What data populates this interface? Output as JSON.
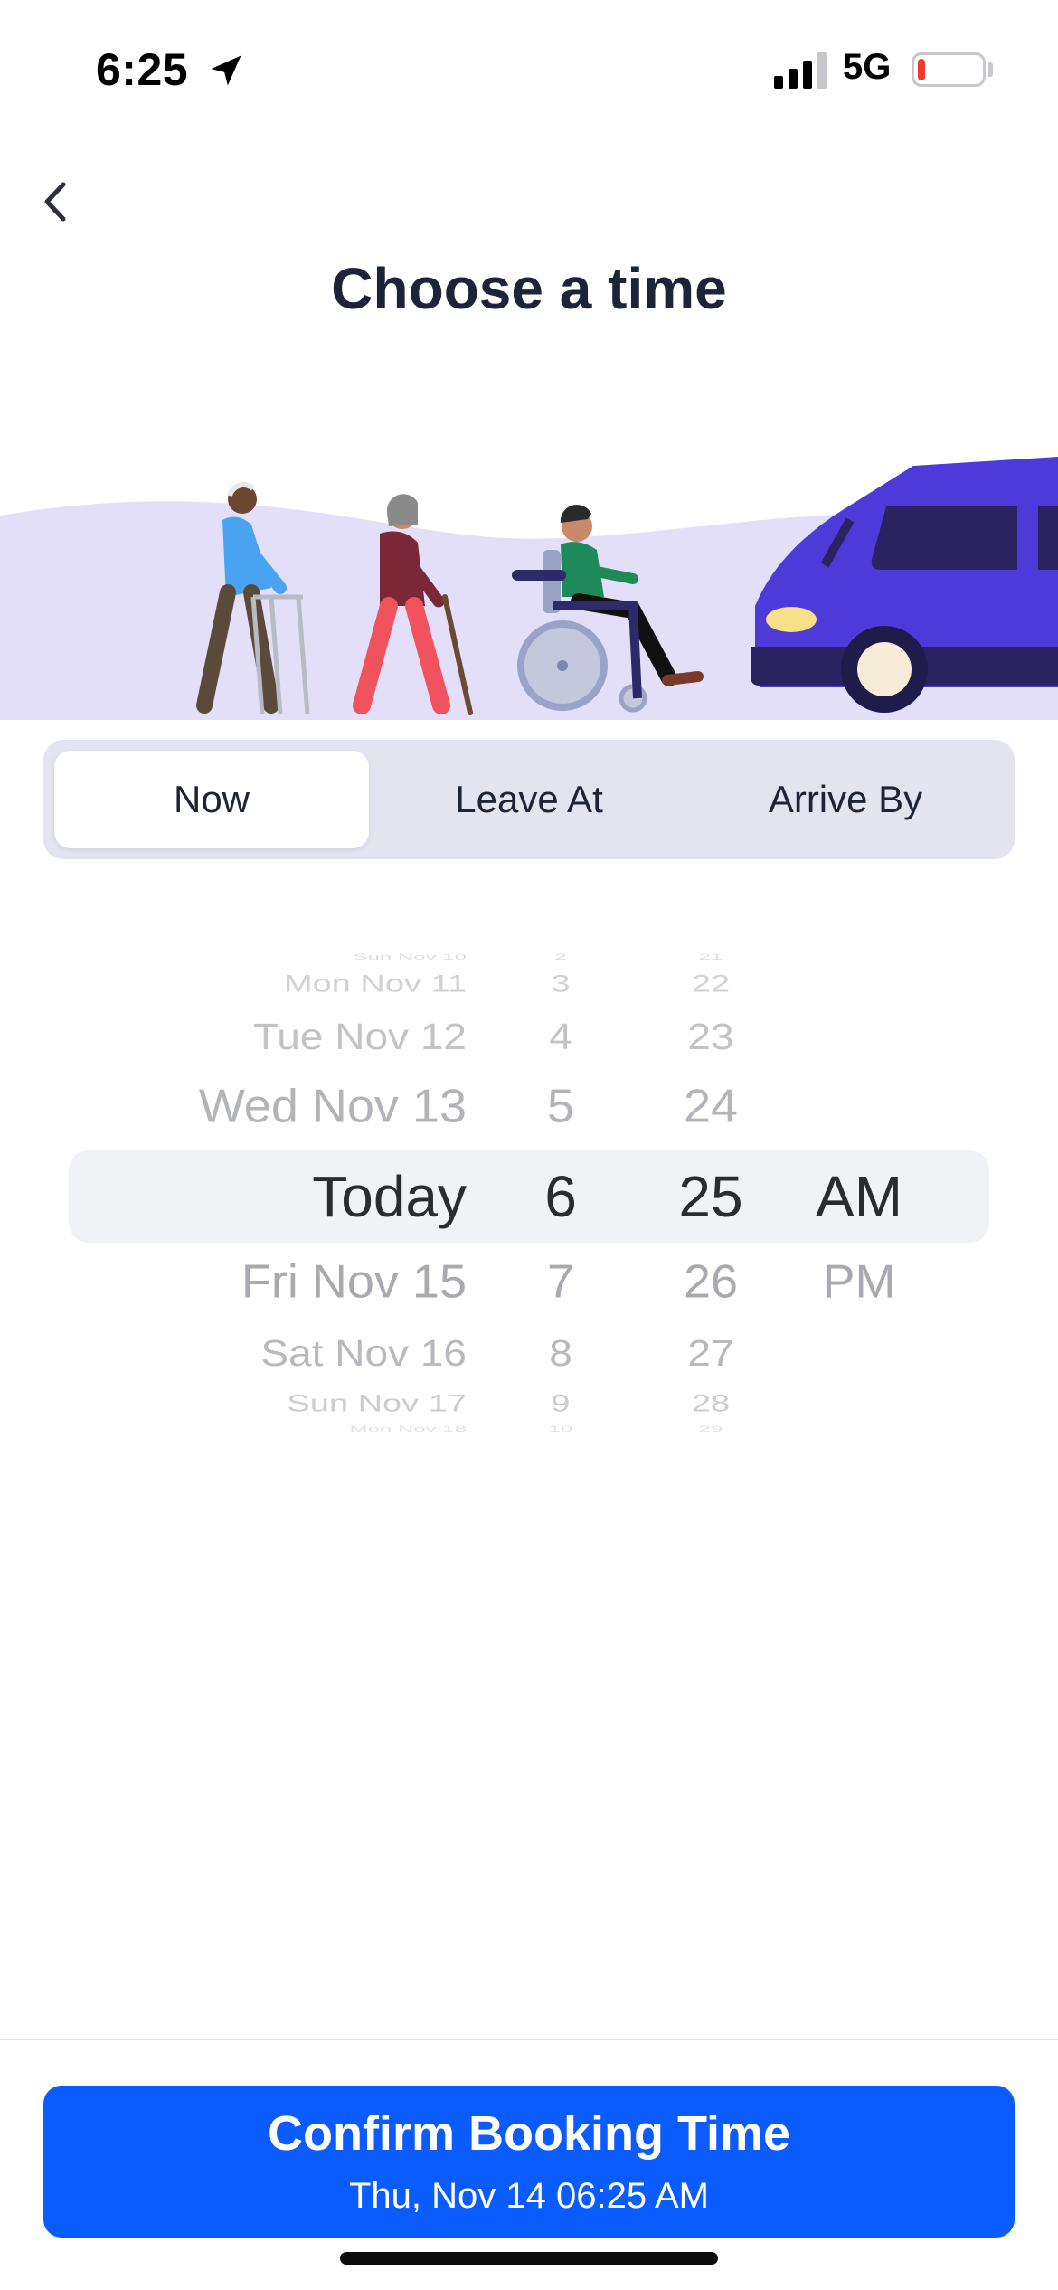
{
  "status_bar": {
    "time": "6:25",
    "network": "5G",
    "battery_level": 0.12,
    "battery_color": "#f2392d"
  },
  "header": {
    "title": "Choose a time",
    "back_icon": "chevron-left-icon"
  },
  "segments": [
    {
      "label": "Now",
      "selected": true
    },
    {
      "label": "Leave At",
      "selected": false
    },
    {
      "label": "Arrive By",
      "selected": false
    }
  ],
  "picker": {
    "date_column": [
      "Sun Nov 10",
      "Mon Nov 11",
      "Tue Nov 12",
      "Wed Nov 13",
      "Today",
      "Fri Nov 15",
      "Sat Nov 16",
      "Sun Nov 17",
      "Mon Nov 18"
    ],
    "hour_column": [
      "2",
      "3",
      "4",
      "5",
      "6",
      "7",
      "8",
      "9",
      "10"
    ],
    "minute_column": [
      "21",
      "22",
      "23",
      "24",
      "25",
      "26",
      "27",
      "28",
      "29"
    ],
    "ampm_column": [
      "AM",
      "PM"
    ],
    "selected": {
      "date": "Today",
      "hour": "6",
      "minute": "25",
      "ampm": "AM"
    }
  },
  "confirm": {
    "label": "Confirm Booking Time",
    "sublabel": "Thu, Nov 14 06:25 AM",
    "color": "#0a5cff"
  }
}
